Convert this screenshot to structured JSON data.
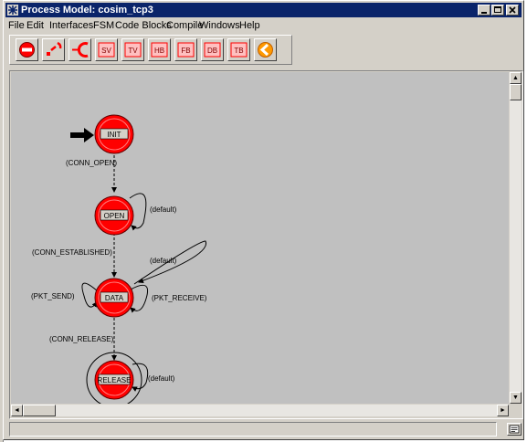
{
  "window": {
    "title": "Process Model: cosim_tcp3",
    "minimize_icon": "minimize-icon",
    "maximize_icon": "maximize-icon",
    "close_icon": "close-icon"
  },
  "menu": [
    "File",
    "Edit",
    "Interfaces",
    "FSM",
    "Code Blocks",
    "Compile",
    "Windows",
    "Help"
  ],
  "toolbar": {
    "buttons": [
      {
        "name": "create-state-icon"
      },
      {
        "name": "create-transition-icon"
      },
      {
        "name": "create-loop-icon"
      },
      {
        "name": "state-variables-icon",
        "text": "SV"
      },
      {
        "name": "temporary-variables-icon",
        "text": "TV"
      },
      {
        "name": "header-block-icon",
        "text": "HB"
      },
      {
        "name": "function-block-icon",
        "text": "FB"
      },
      {
        "name": "diagnostic-block-icon",
        "text": "DB"
      },
      {
        "name": "termination-block-icon",
        "text": "TB"
      },
      {
        "name": "compile-icon"
      }
    ]
  },
  "fsm": {
    "states": [
      {
        "name": "INIT"
      },
      {
        "name": "OPEN"
      },
      {
        "name": "DATA"
      },
      {
        "name": "RELEASE"
      }
    ],
    "transitions": [
      {
        "label": "(CONN_OPEN)"
      },
      {
        "label": "(default)"
      },
      {
        "label": "(CONN_ESTABLISHED)"
      },
      {
        "label": "(default)"
      },
      {
        "label": "(PKT_SEND)"
      },
      {
        "label": "(PKT_RECEIVE)"
      },
      {
        "label": "(CONN_RELEASE)"
      },
      {
        "label": "(default)"
      }
    ],
    "colors": {
      "state_fill": "#ff0000",
      "canvas": "#c0c0c0",
      "label_box": "#d4d0c8"
    }
  },
  "scroll": {
    "up": "▲",
    "down": "▼",
    "left": "◄",
    "right": "►"
  }
}
